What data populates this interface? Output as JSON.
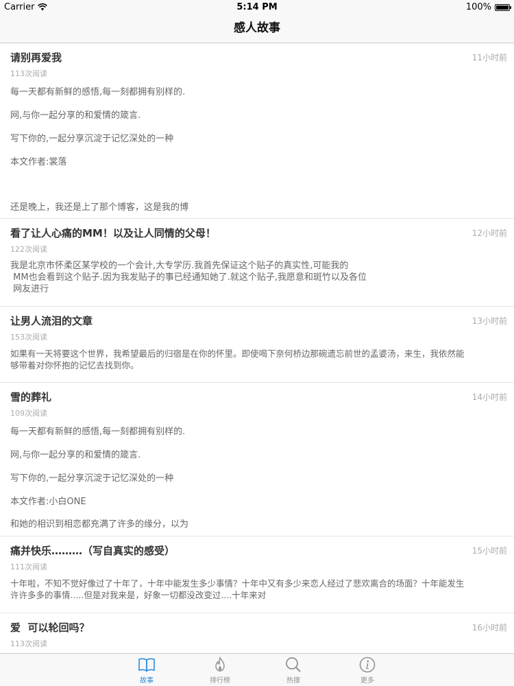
{
  "status_bar": {
    "carrier": "Carrier",
    "time": "5:14 PM",
    "battery": "100%",
    "battery_level": 1.0
  },
  "nav": {
    "title": "感人故事"
  },
  "stories": [
    {
      "title": "请别再爱我",
      "time": "11小时前",
      "reads": "113次阅读",
      "lines": [
        "每一天都有新鲜的感悟,每一刻都拥有别样的.",
        "网,与你一起分享的和爱情的箴言.",
        "写下你的,一起分享沉淀于记忆深处的一种",
        "本文作者:裳落",
        "",
        "还是晚上，我还是上了那个博客，这是我的博"
      ]
    },
    {
      "title": "看了让人心痛的MM！以及让人同情的父母！",
      "time": "12小时前",
      "reads": "122次阅读",
      "lines": [
        "我是北京市怀柔区某学校的一个会计,大专学历.我首先保证这个贴子的真实性,可能我的",
        " MM也会看到这个贴子.因为我发贴子的事已经通知她了.就这个贴子,我愿意和斑竹以及各位",
        " 网友进行"
      ]
    },
    {
      "title": "让男人流泪的文章",
      "time": "13小时前",
      "reads": "153次阅读",
      "lines": [
        "如果有一天将要这个世界，我希望最后的归宿是在你的怀里。即使喝下奈何桥边那碗遗忘前世的孟婆汤，来生，我依然能",
        "够带着对你怀抱的记忆去找到你。"
      ]
    },
    {
      "title": "雪的葬礼",
      "time": "14小时前",
      "reads": "109次阅读",
      "lines": [
        "每一天都有新鲜的感悟,每一刻都拥有别样的.",
        "网,与你一起分享的和爱情的箴言.",
        "写下你的,一起分享沉淀于记忆深处的一种",
        "本文作者:小白ONE",
        "和她的相识到相恋都充满了许多的缘分，以为"
      ]
    },
    {
      "title": "痛并快乐………（写自真实的感受）",
      "time": "15小时前",
      "reads": "111次阅读",
      "lines": [
        "十年啦，不知不觉好像过了十年了，十年中能发生多少事情？十年中又有多少来恋人经过了悲欢离合的场面？十年能发生",
        "许许多多的事情.....但是对我来是，好象一切都没改变过....十年来对"
      ]
    },
    {
      "title": "爱  可以轮回吗？",
      "time": "16小时前",
      "reads": "113次阅读",
      "lines": []
    }
  ],
  "tabs": [
    {
      "label": "故事",
      "icon": "book-icon",
      "active": true
    },
    {
      "label": "排行榜",
      "icon": "flame-icon",
      "active": false
    },
    {
      "label": "热搜",
      "icon": "search-icon",
      "active": false
    },
    {
      "label": "更多",
      "icon": "info-icon",
      "active": false
    }
  ],
  "colors": {
    "accent": "#2a8be0",
    "inactive": "#929292"
  }
}
